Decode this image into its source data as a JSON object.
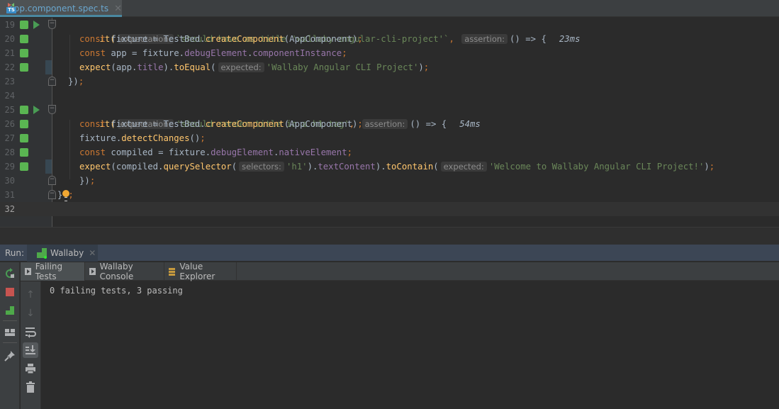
{
  "editor_tab": {
    "label": "app.component.spec.ts",
    "icon": "typescript-file-icon",
    "icon_text": "TS"
  },
  "editor": {
    "lines": [
      {
        "n": "19"
      },
      {
        "n": "20"
      },
      {
        "n": "21"
      },
      {
        "n": "22"
      },
      {
        "n": "23"
      },
      {
        "n": "24"
      },
      {
        "n": "25"
      },
      {
        "n": "26"
      },
      {
        "n": "27"
      },
      {
        "n": "28"
      },
      {
        "n": "29"
      },
      {
        "n": "30"
      },
      {
        "n": "31"
      },
      {
        "n": "32"
      }
    ],
    "code": {
      "l19": {
        "it": "it(",
        "hint": "expectation:",
        "str": "`should have as title 'wallaby-angular-cli-project'`",
        "comma": ",",
        "hint2": "assertion:",
        "rest": "() => {",
        "time": "23ms"
      },
      "l20": {
        "kw": "const",
        "a": " fixture = TestBed.",
        "fn": "createComponent",
        "b": "(AppComponent)",
        "semi": ";"
      },
      "l21": {
        "kw": "const",
        "a": " app = fixture.",
        "p1": "debugElement",
        "dot": ".",
        "p2": "componentInstance",
        "semi": ";"
      },
      "l22": {
        "fn1": "expect",
        "a": "(app.",
        "p": "title",
        "b": ").",
        "fn2": "toEqual",
        "c": "(",
        "hint": "expected:",
        "str": "'Wallaby Angular CLI Project'",
        "d": ")",
        "semi": ";"
      },
      "l23": {
        "a": "})",
        "semi": ";"
      },
      "l25": {
        "it": "it(",
        "hint": "expectation:",
        "str": "'should render title in a h1 tag'",
        "comma": ",",
        "hint2": "assertion:",
        "rest": "() => {",
        "time": "54ms"
      },
      "l26": {
        "kw": "const",
        "a": " fixture = TestBed.",
        "fn": "createComponent",
        "b": "(AppComponent)",
        "semi": ";"
      },
      "l27": {
        "a": "fixture.",
        "fn": "detectChanges",
        "b": "()",
        "semi": ";"
      },
      "l28": {
        "kw": "const",
        "a": " compiled = fixture.",
        "p1": "debugElement",
        "dot": ".",
        "p2": "nativeElement",
        "semi": ";"
      },
      "l29": {
        "fn1": "expect",
        "a": "(compiled.",
        "fn2": "querySelector",
        "b": "(",
        "hint": "selectors:",
        "str": "'h1'",
        "c": ").",
        "p": "textContent",
        "d": ").",
        "fn3": "toContain",
        "e": "(",
        "hint2": "expected:",
        "str2": "'Welcome to Wallaby Angular CLI Project!'",
        "f": ")",
        "semi": ";"
      },
      "l30": {
        "a": "})",
        "semi": ";"
      },
      "l31": {
        "a": "}",
        "semi": ";"
      }
    },
    "colors": {
      "coverage": "#5ab552",
      "keyword": "#cc7832",
      "function": "#ffc66d",
      "string": "#6a8759",
      "property": "#9876aa"
    }
  },
  "run_panel": {
    "label": "Run:",
    "tab": {
      "label": "Wallaby",
      "icon": "wallaby-icon"
    },
    "sub_tabs": [
      {
        "label": "Failing Tests",
        "icon": "console-icon",
        "active": true
      },
      {
        "label": "Wallaby Console",
        "icon": "console-icon",
        "active": false
      },
      {
        "label": "Value Explorer",
        "icon": "value-explorer-icon",
        "active": false
      }
    ],
    "console_output": "0 failing tests, 3 passing"
  }
}
